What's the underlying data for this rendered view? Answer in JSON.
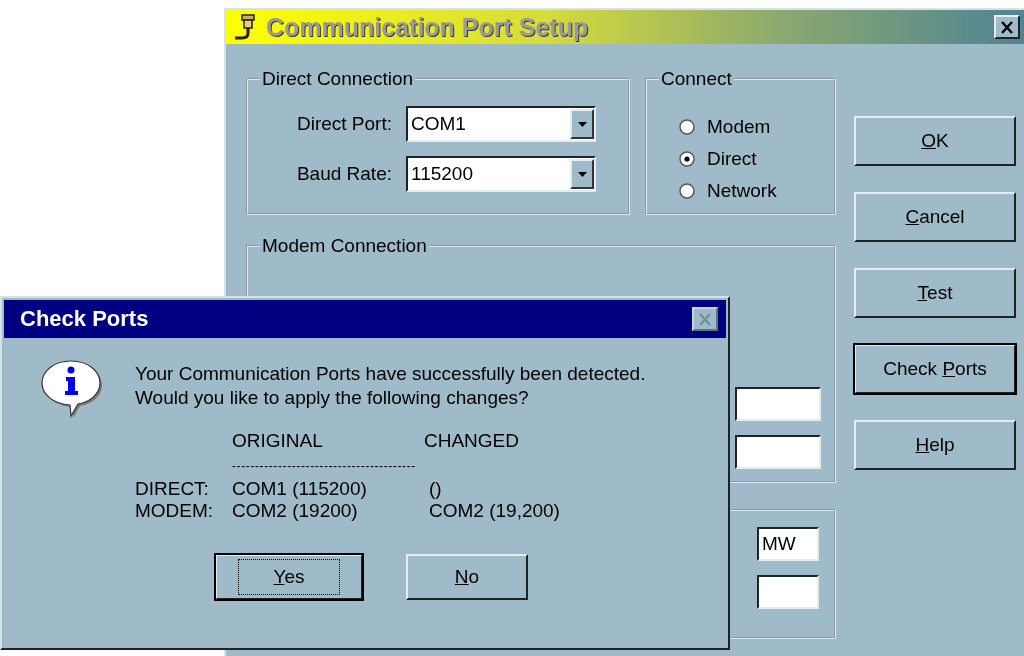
{
  "main_window": {
    "title": "Communication Port Setup",
    "active": false,
    "direct_connection": {
      "legend": "Direct Connection",
      "fields": [
        {
          "label": "Direct Port:",
          "value": "COM1"
        },
        {
          "label": "Baud Rate:",
          "value": "115200"
        }
      ]
    },
    "connect": {
      "legend": "Connect",
      "options": [
        {
          "label": "Modem",
          "selected": false
        },
        {
          "label": "Direct",
          "selected": true
        },
        {
          "label": "Network",
          "selected": false
        }
      ]
    },
    "modem_connection": {
      "legend": "Modem Connection"
    },
    "other_fields": [
      {
        "value": "MW"
      }
    ],
    "buttons": [
      {
        "label": {
          "key": "O",
          "after": "K"
        },
        "default": false
      },
      {
        "label": {
          "key": "C",
          "after": "ancel"
        },
        "default": false
      },
      {
        "label": {
          "key": "T",
          "after": "est"
        },
        "default": false
      },
      {
        "label": {
          "before": "Check ",
          "key": "P",
          "after": "orts"
        },
        "default": true
      },
      {
        "label": {
          "key": "H",
          "after": "elp"
        },
        "default": false
      }
    ]
  },
  "dialog": {
    "title": "Check Ports",
    "close_enabled": false,
    "message_lines": [
      "Your Communication Ports have successfully been detected.",
      "Would you like to apply the following changes?"
    ],
    "table": {
      "columns": [
        "ORIGINAL",
        "CHANGED"
      ],
      "separator": "----------------------------------------",
      "rows": [
        {
          "label": "DIRECT:",
          "original": "COM1 (115200)",
          "changed": "()"
        },
        {
          "label": "MODEM:",
          "original": "COM2 (19200)",
          "changed": "COM2 (19,200)"
        }
      ]
    },
    "buttons": [
      {
        "label": {
          "key": "Y",
          "after": "es"
        },
        "default": true
      },
      {
        "label": {
          "key": "N",
          "after": "o"
        },
        "default": false
      }
    ]
  }
}
